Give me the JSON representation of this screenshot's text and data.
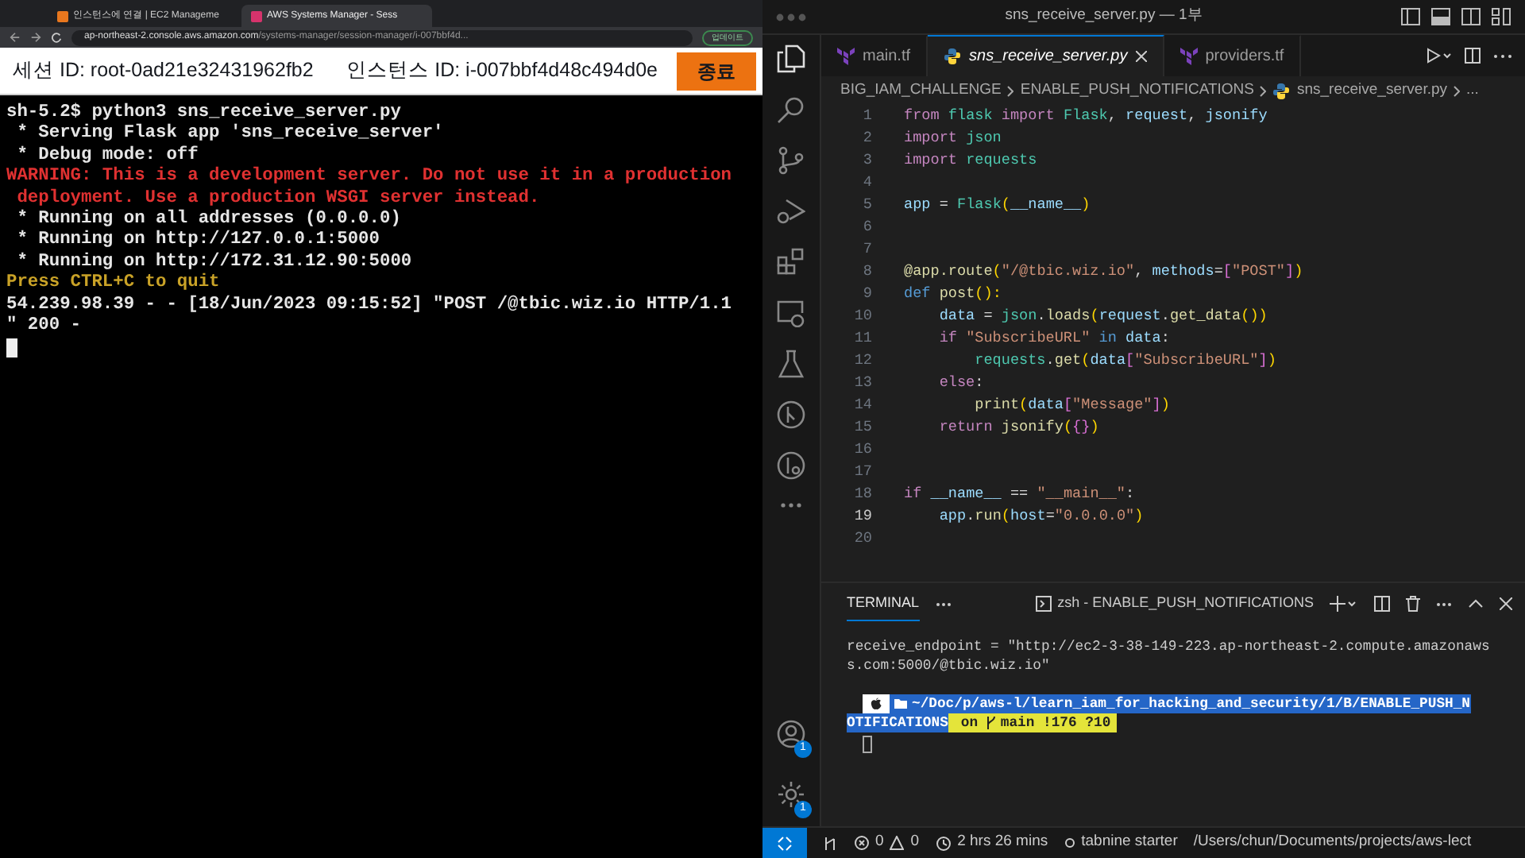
{
  "browser": {
    "tabs": [
      {
        "title": "인스턴스에 연결 | EC2 Manageme",
        "color": "#e8771e",
        "selected": false
      },
      {
        "title": "AWS Systems Manager - Sess",
        "color": "#d6336c",
        "selected": true
      }
    ],
    "url_host": "ap-northeast-2.console.aws.amazon.com",
    "url_path": "/systems-manager/session-manager/i-007bbf4d...",
    "update_button": "업데이트"
  },
  "session_bar": {
    "session_id": "세션 ID: root-0ad21e32431962fb2",
    "instance_id": "인스턴스 ID: i-007bbf4d48c494d0e",
    "terminate_button": "종료"
  },
  "shell_output": [
    {
      "text": "sh-5.2$ python3 sns_receive_server.py",
      "kind": "normal"
    },
    {
      "text": " * Serving Flask app 'sns_receive_server'",
      "kind": "normal"
    },
    {
      "text": " * Debug mode: off",
      "kind": "normal"
    },
    {
      "text": "WARNING: This is a development server. Do not use it in a production",
      "kind": "warning"
    },
    {
      "text": " deployment. Use a production WSGI server instead.",
      "kind": "warning"
    },
    {
      "text": " * Running on all addresses (0.0.0.0)",
      "kind": "normal"
    },
    {
      "text": " * Running on http://127.0.0.1:5000",
      "kind": "normal"
    },
    {
      "text": " * Running on http://172.31.12.90:5000",
      "kind": "normal"
    },
    {
      "text": "Press CTRL+C to quit",
      "kind": "hint"
    },
    {
      "text": "54.239.98.39 - - [18/Jun/2023 09:15:52] \"POST /@tbic.wiz.io HTTP/1.1",
      "kind": "normal"
    },
    {
      "text": "\" 200 -",
      "kind": "normal"
    }
  ],
  "editor": {
    "window_title": "sns_receive_server.py — 1부",
    "tabs": [
      {
        "label": "main.tf",
        "kind": "terraform",
        "selected": false,
        "preview": false
      },
      {
        "label": "sns_receive_server.py",
        "kind": "python",
        "selected": true,
        "preview": true
      },
      {
        "label": "providers.tf",
        "kind": "terraform",
        "selected": false,
        "preview": false
      }
    ],
    "breadcrumb": [
      "BIG_IAM_CHALLENGE",
      "ENABLE_PUSH_NOTIFICATIONS",
      "sns_receive_server.py",
      "..."
    ],
    "code": [
      {
        "number": "1",
        "current": false,
        "tokens": [
          {
            "text": "from ",
            "kind": "kw"
          },
          {
            "text": "flask ",
            "kind": "mod"
          },
          {
            "text": "import ",
            "kind": "kw"
          },
          {
            "text": "Flask",
            "kind": "mod"
          },
          {
            "text": ", ",
            "kind": "p"
          },
          {
            "text": "request",
            "kind": "var"
          },
          {
            "text": ", ",
            "kind": "p"
          },
          {
            "text": "jsonify",
            "kind": "var"
          }
        ]
      },
      {
        "number": "2",
        "current": false,
        "tokens": [
          {
            "text": "import ",
            "kind": "kw"
          },
          {
            "text": "json",
            "kind": "mod"
          }
        ]
      },
      {
        "number": "3",
        "current": false,
        "tokens": [
          {
            "text": "import ",
            "kind": "kw"
          },
          {
            "text": "requests",
            "kind": "mod"
          }
        ]
      },
      {
        "number": "4",
        "current": false
      },
      {
        "number": "5",
        "current": false,
        "tokens": [
          {
            "text": "app",
            "kind": "var"
          },
          {
            "text": " = ",
            "kind": "p"
          },
          {
            "text": "Flask",
            "kind": "mod"
          },
          {
            "text": "(",
            "kind": "br"
          },
          {
            "text": "__name__",
            "kind": "var"
          },
          {
            "text": ")",
            "kind": "br"
          }
        ]
      },
      {
        "number": "6",
        "current": false
      },
      {
        "number": "7",
        "current": false
      },
      {
        "number": "8",
        "current": false,
        "tokens": [
          {
            "text": "@app.route",
            "kind": "fn"
          },
          {
            "text": "(",
            "kind": "br"
          },
          {
            "text": "\"/@tbic.wiz.io\"",
            "kind": "str"
          },
          {
            "text": ", ",
            "kind": "p"
          },
          {
            "text": "methods",
            "kind": "var"
          },
          {
            "text": "=",
            "kind": "p"
          },
          {
            "text": "[",
            "kind": "br2"
          },
          {
            "text": "\"POST\"",
            "kind": "str"
          },
          {
            "text": "]",
            "kind": "br2"
          },
          {
            "text": ")",
            "kind": "br"
          }
        ]
      },
      {
        "number": "9",
        "current": false,
        "tokens": [
          {
            "text": "def ",
            "kind": "def"
          },
          {
            "text": "post",
            "kind": "fn"
          },
          {
            "text": "():",
            "kind": "br"
          }
        ]
      },
      {
        "number": "10",
        "current": false,
        "tokens": [
          {
            "text": "    data",
            "kind": "var"
          },
          {
            "text": " = ",
            "kind": "p"
          },
          {
            "text": "json",
            "kind": "mod"
          },
          {
            "text": ".",
            "kind": "p"
          },
          {
            "text": "loads",
            "kind": "fn"
          },
          {
            "text": "(",
            "kind": "br"
          },
          {
            "text": "request",
            "kind": "var"
          },
          {
            "text": ".",
            "kind": "p"
          },
          {
            "text": "get_data",
            "kind": "fn"
          },
          {
            "text": "())",
            "kind": "br"
          }
        ]
      },
      {
        "number": "11",
        "current": false,
        "tokens": [
          {
            "text": "    if ",
            "kind": "kw"
          },
          {
            "text": "\"SubscribeURL\"",
            "kind": "str"
          },
          {
            "text": " in ",
            "kind": "def"
          },
          {
            "text": "data",
            "kind": "var"
          },
          {
            "text": ":",
            "kind": "p"
          }
        ]
      },
      {
        "number": "12",
        "current": false,
        "tokens": [
          {
            "text": "        requests",
            "kind": "mod"
          },
          {
            "text": ".",
            "kind": "p"
          },
          {
            "text": "get",
            "kind": "fn"
          },
          {
            "text": "(",
            "kind": "br"
          },
          {
            "text": "data",
            "kind": "var"
          },
          {
            "text": "[",
            "kind": "br2"
          },
          {
            "text": "\"SubscribeURL\"",
            "kind": "str"
          },
          {
            "text": "]",
            "kind": "br2"
          },
          {
            "text": ")",
            "kind": "br"
          }
        ]
      },
      {
        "number": "13",
        "current": false,
        "tokens": [
          {
            "text": "    else",
            "kind": "kw"
          },
          {
            "text": ":",
            "kind": "p"
          }
        ]
      },
      {
        "number": "14",
        "current": false,
        "tokens": [
          {
            "text": "        print",
            "kind": "fn"
          },
          {
            "text": "(",
            "kind": "br"
          },
          {
            "text": "data",
            "kind": "var"
          },
          {
            "text": "[",
            "kind": "br2"
          },
          {
            "text": "\"Message\"",
            "kind": "str"
          },
          {
            "text": "]",
            "kind": "br2"
          },
          {
            "text": ")",
            "kind": "br"
          }
        ]
      },
      {
        "number": "15",
        "current": false,
        "tokens": [
          {
            "text": "    return ",
            "kind": "kw"
          },
          {
            "text": "jsonify",
            "kind": "fn"
          },
          {
            "text": "(",
            "kind": "br"
          },
          {
            "text": "{}",
            "kind": "br2"
          },
          {
            "text": ")",
            "kind": "br"
          }
        ]
      },
      {
        "number": "16",
        "current": false
      },
      {
        "number": "17",
        "current": false
      },
      {
        "number": "18",
        "current": false,
        "tokens": [
          {
            "text": "if ",
            "kind": "kw"
          },
          {
            "text": "__name__",
            "kind": "var"
          },
          {
            "text": " == ",
            "kind": "p"
          },
          {
            "text": "\"__main__\"",
            "kind": "str"
          },
          {
            "text": ":",
            "kind": "p"
          }
        ]
      },
      {
        "number": "19",
        "current": true,
        "tokens": [
          {
            "text": "    app",
            "kind": "var"
          },
          {
            "text": ".",
            "kind": "p"
          },
          {
            "text": "run",
            "kind": "fn"
          },
          {
            "text": "(",
            "kind": "br"
          },
          {
            "text": "host",
            "kind": "var"
          },
          {
            "text": "=",
            "kind": "p"
          },
          {
            "text": "\"0.0.0.0\"",
            "kind": "str"
          },
          {
            "text": ")",
            "kind": "br"
          }
        ]
      },
      {
        "number": "20",
        "current": false
      }
    ]
  },
  "panel": {
    "tab": "TERMINAL",
    "shell": "zsh - ENABLE_PUSH_NOTIFICATIONS",
    "output": [
      "receive_endpoint = \"http://ec2-3-38-149-223.ap-northeast-2.compute.amazonaws",
      "s.com:5000/@tbic.wiz.io\""
    ],
    "prompt_path_1": "~/Doc/p/aws-l/learn_iam_for_hacking_and_security/1/B/ENABLE_PUSH_N",
    "prompt_path_2": "OTIFICATIONS",
    "prompt_git_on": "on",
    "prompt_git_branch": "main !176 ?10"
  },
  "activity_badges": {
    "accounts": "1",
    "settings": "1"
  },
  "status_bar": {
    "problems_errors": "0",
    "problems_warnings": "0",
    "time": "2 hrs 26 mins",
    "tabnine": "tabnine starter",
    "path": "/Users/chun/Documents/projects/aws-lect"
  }
}
